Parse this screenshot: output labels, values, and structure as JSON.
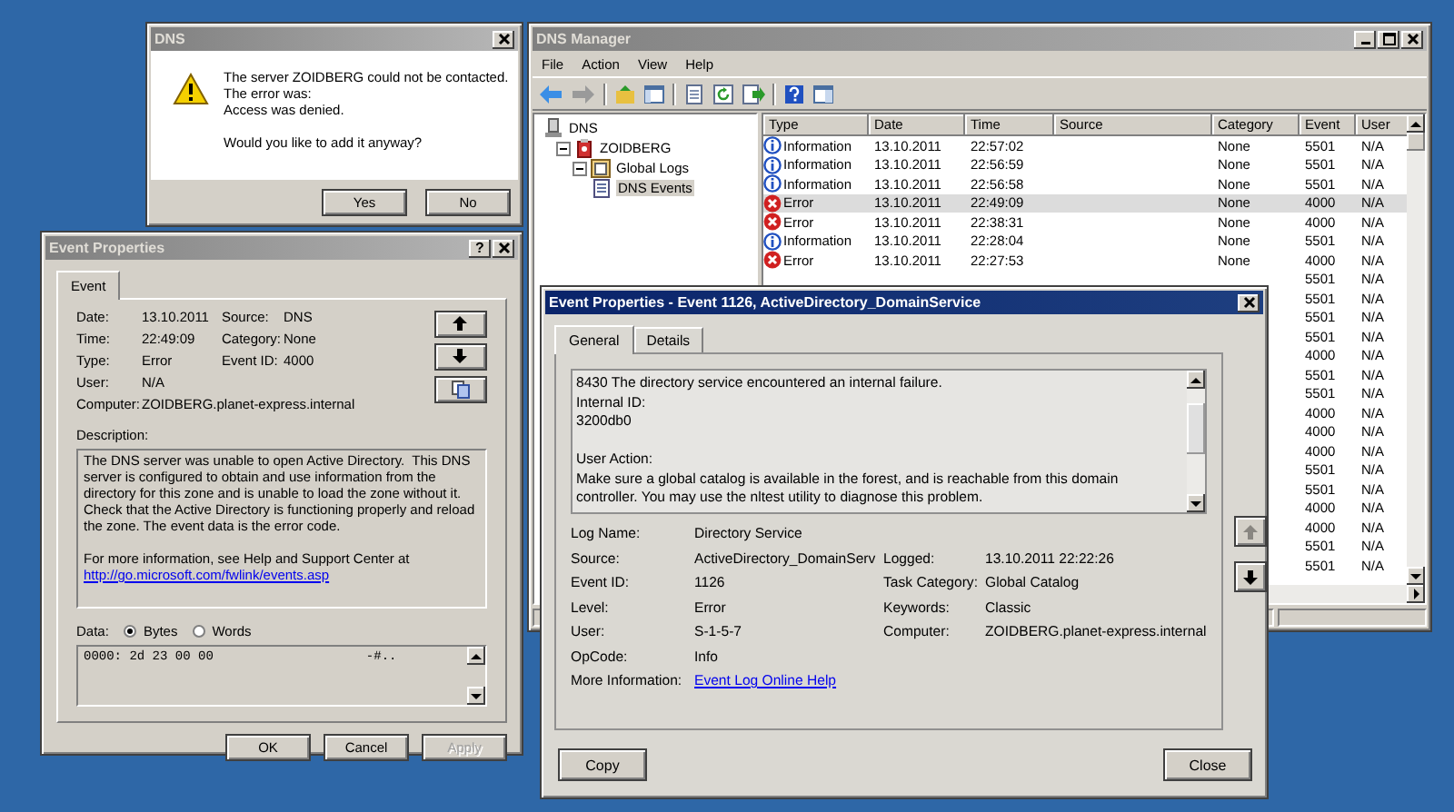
{
  "dns_dialog": {
    "title": "DNS",
    "active": false,
    "message": "The server ZOIDBERG could not be contacted.\nThe error was:\nAccess was denied.",
    "question": "Would you like to add it anyway?",
    "buttons": [
      {
        "label": "Yes",
        "disabled": false
      },
      {
        "label": "No",
        "disabled": false
      }
    ]
  },
  "event_properties_dialog": {
    "title": "Event Properties",
    "active": false,
    "help_button": "?",
    "tabs": [
      {
        "label": "Event",
        "selected": true
      }
    ],
    "field_rows": [
      [
        {
          "label": "Date:",
          "value": "13.10.2011"
        },
        {
          "label": "Source:",
          "value": "DNS"
        }
      ],
      [
        {
          "label": "Time:",
          "value": "22:49:09"
        },
        {
          "label": "Category:",
          "value": "None"
        }
      ],
      [
        {
          "label": "Type:",
          "value": "Error"
        },
        {
          "label": "Event ID:",
          "value": "4000"
        }
      ],
      [
        {
          "label": "User:",
          "value": "N/A"
        }
      ],
      [
        {
          "label": "Computer:",
          "value": "ZOIDBERG.planet-express.internal"
        }
      ]
    ],
    "nav_buttons": [
      {
        "kind": "up"
      },
      {
        "kind": "down"
      },
      {
        "kind": "copy"
      }
    ],
    "description_label": "Description:",
    "description": "The DNS server was unable to open Active Directory.  This DNS server is configured to obtain and use information from the directory for this zone and is unable to load the zone without it.  Check that the Active Directory is functioning properly and reload the zone. The event data is the error code.",
    "more_info": "For more information, see Help and Support Center at",
    "link": "http://go.microsoft.com/fwlink/events.asp",
    "data_label": "Data:",
    "data_format": [
      {
        "label": "Bytes",
        "selected": true
      },
      {
        "label": "Words",
        "selected": false
      }
    ],
    "data": "0000: 2d 23 00 00                    -#..",
    "buttons": [
      {
        "label": "OK",
        "disabled": false
      },
      {
        "label": "Cancel",
        "disabled": false
      },
      {
        "label": "Apply",
        "disabled": true
      }
    ]
  },
  "dns_manager": {
    "title": "DNS Manager",
    "active": false,
    "menu": [
      "File",
      "Action",
      "View",
      "Help"
    ],
    "tree": [
      {
        "label": "DNS",
        "kind": "root",
        "selected": false,
        "children": [
          {
            "label": "ZOIDBERG",
            "kind": "server",
            "expanded": true,
            "selected": false,
            "children": [
              {
                "label": "Global Logs",
                "kind": "logs",
                "expanded": true,
                "selected": false,
                "children": [
                  {
                    "label": "DNS Events",
                    "kind": "events",
                    "selected": true
                  }
                ]
              }
            ]
          }
        ]
      }
    ],
    "columns": [
      "Type",
      "Date",
      "Time",
      "Source",
      "Category",
      "Event",
      "User"
    ],
    "rows": [
      {
        "kind": "information",
        "type": "Information",
        "date": "13.10.2011",
        "time": "22:57:02",
        "category": "None",
        "event": "5501",
        "user": "N/A",
        "selected": false
      },
      {
        "kind": "information",
        "type": "Information",
        "date": "13.10.2011",
        "time": "22:56:59",
        "category": "None",
        "event": "5501",
        "user": "N/A",
        "selected": false
      },
      {
        "kind": "information",
        "type": "Information",
        "date": "13.10.2011",
        "time": "22:56:58",
        "category": "None",
        "event": "5501",
        "user": "N/A",
        "selected": false
      },
      {
        "kind": "error",
        "type": "Error",
        "date": "13.10.2011",
        "time": "22:49:09",
        "category": "None",
        "event": "4000",
        "user": "N/A",
        "selected": true
      },
      {
        "kind": "error",
        "type": "Error",
        "date": "13.10.2011",
        "time": "22:38:31",
        "category": "None",
        "event": "4000",
        "user": "N/A",
        "selected": false
      },
      {
        "kind": "information",
        "type": "Information",
        "date": "13.10.2011",
        "time": "22:28:04",
        "category": "None",
        "event": "5501",
        "user": "N/A",
        "selected": false
      },
      {
        "kind": "error",
        "type": "Error",
        "date": "13.10.2011",
        "time": "22:27:53",
        "category": "None",
        "event": "4000",
        "user": "N/A",
        "selected": false
      }
    ],
    "covered_rows": [
      {
        "event": "5501",
        "user": "N/A"
      },
      {
        "event": "5501",
        "user": "N/A"
      },
      {
        "event": "5501",
        "user": "N/A"
      },
      {
        "event": "5501",
        "user": "N/A"
      },
      {
        "event": "4000",
        "user": "N/A"
      },
      {
        "event": "5501",
        "user": "N/A"
      },
      {
        "event": "5501",
        "user": "N/A"
      },
      {
        "event": "4000",
        "user": "N/A"
      },
      {
        "event": "4000",
        "user": "N/A"
      },
      {
        "event": "4000",
        "user": "N/A"
      },
      {
        "event": "5501",
        "user": "N/A"
      },
      {
        "event": "5501",
        "user": "N/A"
      },
      {
        "event": "4000",
        "user": "N/A"
      },
      {
        "event": "4000",
        "user": "N/A"
      },
      {
        "event": "5501",
        "user": "N/A"
      },
      {
        "event": "5501",
        "user": "N/A"
      }
    ]
  },
  "event_window": {
    "title": "Event Properties - Event 1126, ActiveDirectory_DomainService",
    "active": true,
    "tabs": [
      {
        "label": "General",
        "selected": true
      },
      {
        "label": "Details",
        "selected": false
      }
    ],
    "message": "8430 The directory service encountered an internal failure.\nInternal ID:\n3200db0\n\nUser Action:\nMake sure a global catalog is available in the forest, and is reachable from this domain controller. You may use the nltest utility to diagnose this problem.",
    "field_rows": [
      [
        {
          "label": "Log Name:",
          "value": "Directory Service"
        }
      ],
      [
        {
          "label": "Source:",
          "value": "ActiveDirectory_DomainServ"
        },
        {
          "label": "Logged:",
          "value": "13.10.2011 22:22:26"
        }
      ],
      [
        {
          "label": "Event ID:",
          "value": "1126"
        },
        {
          "label": "Task Category:",
          "value": "Global Catalog"
        }
      ],
      [
        {
          "label": "Level:",
          "value": "Error"
        },
        {
          "label": "Keywords:",
          "value": "Classic"
        }
      ],
      [
        {
          "label": "User:",
          "value": "S-1-5-7"
        },
        {
          "label": "Computer:",
          "value": "ZOIDBERG.planet-express.internal"
        }
      ],
      [
        {
          "label": "OpCode:",
          "value": "Info"
        }
      ],
      [
        {
          "label": "More Information:",
          "link": "Event Log Online Help"
        }
      ]
    ],
    "nav_buttons": [
      {
        "kind": "up",
        "disabled": true
      },
      {
        "kind": "down",
        "disabled": false
      }
    ],
    "buttons": [
      {
        "label": "Copy",
        "disabled": false
      },
      {
        "label": "Close",
        "disabled": false
      }
    ]
  }
}
